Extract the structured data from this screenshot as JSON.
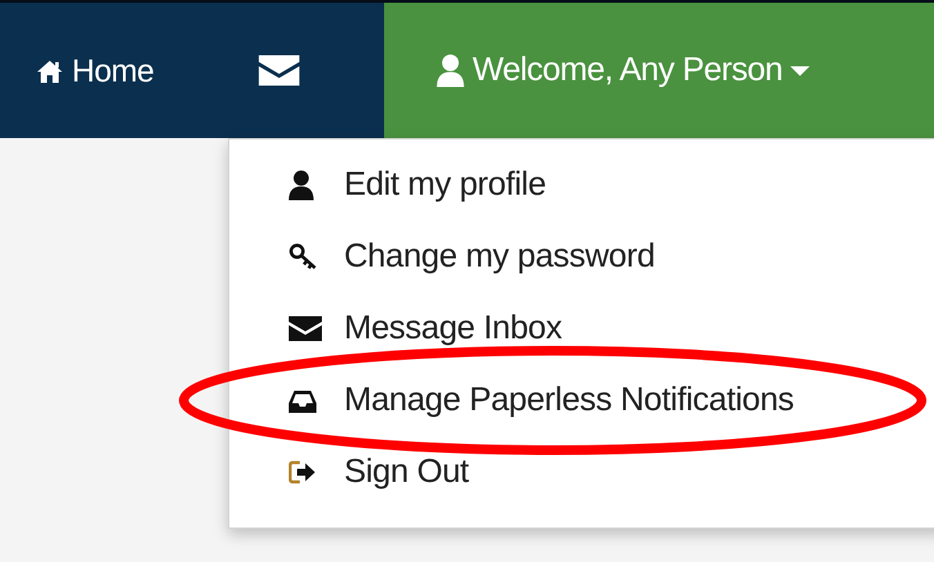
{
  "navbar": {
    "home_link": {
      "label": "Home"
    },
    "user_menu": {
      "label": "Welcome, Any Person",
      "expanded": true
    }
  },
  "dropdown": {
    "items": [
      {
        "label": "Edit my profile"
      },
      {
        "label": "Change my password"
      },
      {
        "label": "Message Inbox"
      },
      {
        "label": "Manage Paperless Notifications"
      },
      {
        "label": "Sign Out"
      }
    ]
  },
  "annotation": {
    "kind": "ellipse"
  }
}
